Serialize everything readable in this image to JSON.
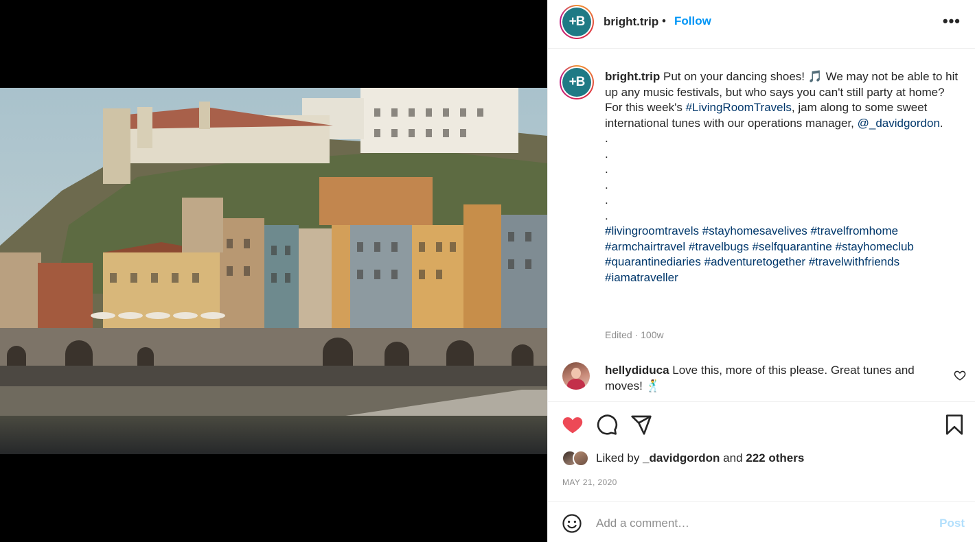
{
  "post": {
    "username": "bright.trip",
    "separator": "•",
    "follow_label": "Follow",
    "more_label": "•••",
    "avatar_text": "+B"
  },
  "caption": {
    "username": "bright.trip",
    "text_1": " Put on your dancing shoes! ",
    "music_emoji": "🎵",
    "text_2": " We may not be able to hit up any music festivals, but who says you can't still party at home? For this week's ",
    "hashtag_main": "#LivingRoomTravels",
    "text_3": ", jam along to some sweet international tunes with our operations manager, ",
    "mention": "@_davidgordon",
    "text_4": ".",
    "dots": [
      ".",
      ".",
      ".",
      ".",
      ".",
      "."
    ],
    "hashtags": [
      "#livingroomtravels",
      "#stayhomesavelives",
      "#travelfromhome",
      "#armchairtravel",
      "#travelbugs",
      "#selfquarantine",
      "#stayhomeclub",
      "#quarantinediaries",
      "#adventuretogether",
      "#travelwithfriends",
      "#iamatraveller"
    ],
    "edited": "Edited · 100w"
  },
  "comment": {
    "username": "hellydiduca",
    "text": " Love this, more of this please. Great tunes and moves! ",
    "emoji": "🕺"
  },
  "likes": {
    "prefix": "Liked by ",
    "user": "_davidgordon",
    "middle": " and ",
    "others": "222 others"
  },
  "date": "MAY 21, 2020",
  "add_comment": {
    "placeholder": "Add a comment…",
    "post_label": "Post"
  },
  "colors": {
    "accent": "#0095f6",
    "link": "#00376b",
    "liked_heart": "#ed4956",
    "brand": "#1f7a85"
  },
  "icons": [
    "ellipsis-icon",
    "heart-icon",
    "comment-icon",
    "share-icon",
    "bookmark-icon",
    "emoji-icon"
  ]
}
